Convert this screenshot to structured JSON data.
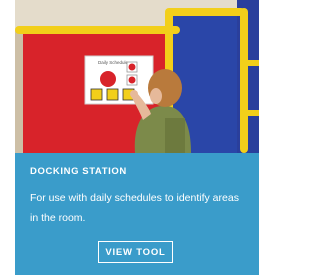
{
  "card": {
    "title": "DOCKING STATION",
    "description": "For use with daily schedules to identify areas in the room.",
    "button_label": "VIEW TOOL",
    "schedule_board_label": "Daily Schedule"
  },
  "colors": {
    "card_background": "#3a9cca",
    "text": "#ffffff",
    "photo_red_panel": "#d8232a",
    "photo_blue_panel": "#2a46a8",
    "photo_frame_yellow": "#f2cf1a"
  }
}
